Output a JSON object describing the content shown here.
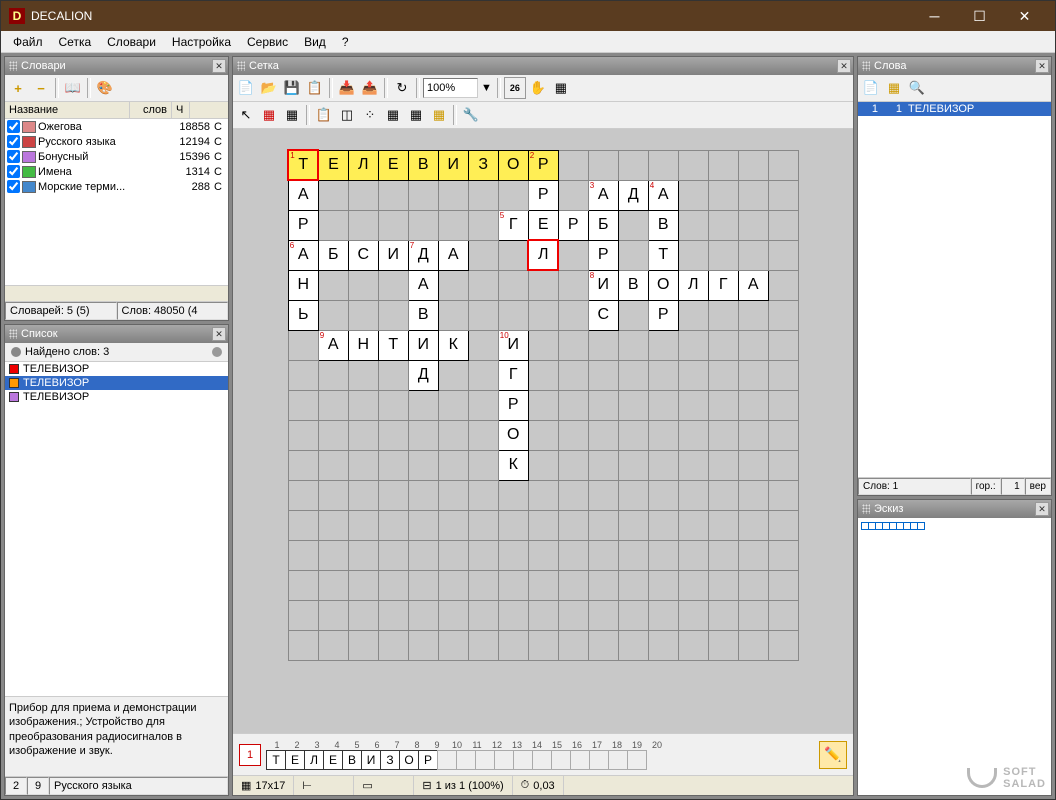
{
  "titlebar": {
    "app": "DECALION"
  },
  "menu": [
    "Файл",
    "Сетка",
    "Словари",
    "Настройка",
    "Сервис",
    "Вид",
    "?"
  ],
  "dict_panel": {
    "title": "Словари",
    "headers": {
      "name": "Название",
      "words": "слов",
      "c": "Ч"
    },
    "rows": [
      {
        "color": "#d88",
        "name": "Ожегова",
        "count": "18858",
        "c": "С"
      },
      {
        "color": "#c44",
        "name": "Русского языка",
        "count": "12194",
        "c": "С"
      },
      {
        "color": "#b7d",
        "name": "Бонусный",
        "count": "15396",
        "c": "С"
      },
      {
        "color": "#4b4",
        "name": "Имена",
        "count": "1314",
        "c": "С"
      },
      {
        "color": "#48c",
        "name": "Морские терми...",
        "count": "288",
        "c": "С"
      }
    ],
    "footer": {
      "dcount": "Словарей: 5 (5)",
      "wcount": "Слов: 48050 (4"
    }
  },
  "list_panel": {
    "title": "Список",
    "found": "Найдено слов: 3",
    "items": [
      {
        "color": "#e00",
        "text": "ТЕЛЕВИЗОР",
        "sel": false
      },
      {
        "color": "#f90",
        "text": "ТЕЛЕВИЗОР",
        "sel": true
      },
      {
        "color": "#b7d",
        "text": "ТЕЛЕВИЗОР",
        "sel": false
      }
    ],
    "definition": "Прибор для приема и демонстрации изображения.; Устройство для преобразования радиосигналов в изображение и звук.",
    "bot": {
      "a": "2",
      "b": "9",
      "c": "Русского языка"
    }
  },
  "grid_panel": {
    "title": "Сетка",
    "zoom": "100%",
    "size": 17,
    "cells": [
      {
        "r": 0,
        "c": 0,
        "t": "Т",
        "n": "1",
        "hl": true,
        "red": true
      },
      {
        "r": 0,
        "c": 1,
        "t": "Е",
        "hl": true
      },
      {
        "r": 0,
        "c": 2,
        "t": "Л",
        "hl": true
      },
      {
        "r": 0,
        "c": 3,
        "t": "Е",
        "hl": true
      },
      {
        "r": 0,
        "c": 4,
        "t": "В",
        "hl": true
      },
      {
        "r": 0,
        "c": 5,
        "t": "И",
        "hl": true
      },
      {
        "r": 0,
        "c": 6,
        "t": "З",
        "hl": true
      },
      {
        "r": 0,
        "c": 7,
        "t": "О",
        "hl": true
      },
      {
        "r": 0,
        "c": 8,
        "t": "Р",
        "n": "2",
        "hl": true
      },
      {
        "r": 1,
        "c": 0,
        "t": "А"
      },
      {
        "r": 1,
        "c": 8,
        "t": "Р"
      },
      {
        "r": 1,
        "c": 10,
        "t": "А",
        "n": "3"
      },
      {
        "r": 1,
        "c": 11,
        "t": "Д"
      },
      {
        "r": 1,
        "c": 12,
        "t": "А",
        "n": "4"
      },
      {
        "r": 2,
        "c": 0,
        "t": "Р"
      },
      {
        "r": 2,
        "c": 7,
        "t": "Г",
        "n": "5"
      },
      {
        "r": 2,
        "c": 8,
        "t": "Е"
      },
      {
        "r": 2,
        "c": 9,
        "t": "Р"
      },
      {
        "r": 2,
        "c": 10,
        "t": "Б"
      },
      {
        "r": 2,
        "c": 12,
        "t": "В"
      },
      {
        "r": 3,
        "c": 0,
        "t": "А",
        "n": "6"
      },
      {
        "r": 3,
        "c": 1,
        "t": "Б"
      },
      {
        "r": 3,
        "c": 2,
        "t": "С"
      },
      {
        "r": 3,
        "c": 3,
        "t": "И"
      },
      {
        "r": 3,
        "c": 4,
        "t": "Д",
        "n": "7"
      },
      {
        "r": 3,
        "c": 5,
        "t": "А"
      },
      {
        "r": 3,
        "c": 8,
        "t": "Л",
        "red": true
      },
      {
        "r": 3,
        "c": 10,
        "t": "Р"
      },
      {
        "r": 3,
        "c": 12,
        "t": "Т"
      },
      {
        "r": 4,
        "c": 0,
        "t": "Н"
      },
      {
        "r": 4,
        "c": 4,
        "t": "А"
      },
      {
        "r": 4,
        "c": 10,
        "t": "И",
        "n": "8"
      },
      {
        "r": 4,
        "c": 11,
        "t": "В"
      },
      {
        "r": 4,
        "c": 12,
        "t": "О"
      },
      {
        "r": 4,
        "c": 13,
        "t": "Л"
      },
      {
        "r": 4,
        "c": 14,
        "t": "Г"
      },
      {
        "r": 4,
        "c": 15,
        "t": "А"
      },
      {
        "r": 5,
        "c": 0,
        "t": "Ь"
      },
      {
        "r": 5,
        "c": 4,
        "t": "В"
      },
      {
        "r": 5,
        "c": 10,
        "t": "С"
      },
      {
        "r": 5,
        "c": 12,
        "t": "Р"
      },
      {
        "r": 6,
        "c": 1,
        "t": "А",
        "n": "9"
      },
      {
        "r": 6,
        "c": 2,
        "t": "Н"
      },
      {
        "r": 6,
        "c": 3,
        "t": "Т"
      },
      {
        "r": 6,
        "c": 4,
        "t": "И"
      },
      {
        "r": 6,
        "c": 5,
        "t": "К"
      },
      {
        "r": 6,
        "c": 7,
        "t": "И",
        "n": "10"
      },
      {
        "r": 7,
        "c": 4,
        "t": "Д"
      },
      {
        "r": 7,
        "c": 7,
        "t": "Г"
      },
      {
        "r": 8,
        "c": 7,
        "t": "Р"
      },
      {
        "r": 9,
        "c": 7,
        "t": "О"
      },
      {
        "r": 10,
        "c": 7,
        "t": "К"
      }
    ]
  },
  "entry": {
    "num": "1",
    "idx": [
      "1",
      "2",
      "3",
      "4",
      "5",
      "6",
      "7",
      "8",
      "9",
      "10",
      "11",
      "12",
      "13",
      "14",
      "15",
      "16",
      "17",
      "18",
      "19",
      "20"
    ],
    "letters": [
      "Т",
      "Е",
      "Л",
      "Е",
      "В",
      "И",
      "З",
      "О",
      "Р"
    ]
  },
  "status": {
    "size": "17x17",
    "pager": "1 из 1 (100%)",
    "time": "0,03"
  },
  "words_panel": {
    "title": "Слова",
    "items": [
      {
        "a": "1",
        "b": "1",
        "c": "ТЕЛЕВИЗОР"
      }
    ],
    "bot": {
      "a": "Слов: 1",
      "b": "гор.:",
      "c": "1",
      "d": "вер"
    }
  },
  "sketch_panel": {
    "title": "Эскиз",
    "mini_count": 9
  },
  "watermark": {
    "a": "SOFT",
    "b": "SALAD"
  }
}
